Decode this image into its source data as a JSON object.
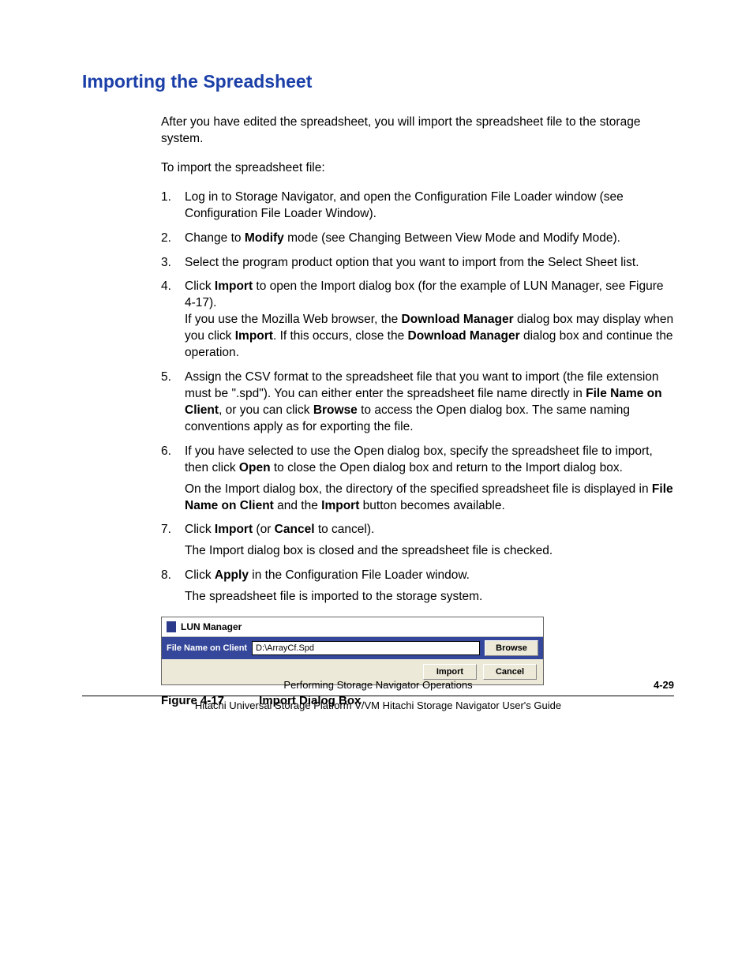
{
  "heading": "Importing the Spreadsheet",
  "intro": "After you have edited the spreadsheet, you will import the spreadsheet file to the storage system.",
  "lead": "To import the spreadsheet file:",
  "steps": {
    "s1": "Log in to Storage Navigator, and open the Configuration File Loader window (see Configuration File Loader Window).",
    "s2_a": "Change to ",
    "s2_b": "Modify",
    "s2_c": " mode (see Changing Between View Mode and Modify Mode).",
    "s3": "Select the program product option that you want to import from the Select Sheet list.",
    "s4_a": "Click ",
    "s4_b": "Import",
    "s4_c": " to open the Import dialog box (for the example of LUN Manager, see Figure 4-17).",
    "s4_2a": "If you use the Mozilla Web browser, the ",
    "s4_2b": "Download Manager",
    "s4_2c": " dialog box may display when you click ",
    "s4_2d": "Import",
    "s4_2e": ". If this occurs, close the ",
    "s4_2f": "Download Manager",
    "s4_2g": " dialog box and continue the operation.",
    "s5_a": "Assign the CSV format to the spreadsheet file that you want to import (the file extension must be \".spd\"). You can either enter the spreadsheet file name directly in ",
    "s5_b": "File Name on Client",
    "s5_c": ", or you can click ",
    "s5_d": "Browse",
    "s5_e": " to access the Open dialog box. The same naming conventions apply as for exporting the file.",
    "s6_a": "If you have selected to use the Open dialog box, specify the spreadsheet file to import, then click ",
    "s6_b": "Open",
    "s6_c": " to close the Open dialog box and return to the Import dialog box.",
    "s6_2a": "On the Import dialog box, the directory of the specified spreadsheet file is displayed in ",
    "s6_2b": "File Name on Client",
    "s6_2c": " and the ",
    "s6_2d": "Import",
    "s6_2e": " button becomes available.",
    "s7_a": "Click ",
    "s7_b": "Import",
    "s7_c": " (or ",
    "s7_d": "Cancel",
    "s7_e": " to cancel).",
    "s7_2": "The Import dialog box is closed and the spreadsheet file is checked.",
    "s8_a": "Click ",
    "s8_b": "Apply",
    "s8_c": " in the Configuration File Loader window.",
    "s8_2": "The spreadsheet file is imported to the storage system."
  },
  "dialog": {
    "title": "LUN Manager",
    "file_label": "File Name on Client",
    "file_value": "D:\\ArrayCf.Spd",
    "browse": "Browse",
    "import": "Import",
    "cancel": "Cancel"
  },
  "figcap_num": "Figure 4-17",
  "figcap_title": "Import Dialog Box",
  "footer": {
    "section": "Performing Storage Navigator Operations",
    "page": "4-29",
    "guide": "Hitachi Universal Storage Platform V/VM Hitachi Storage Navigator User's Guide"
  }
}
